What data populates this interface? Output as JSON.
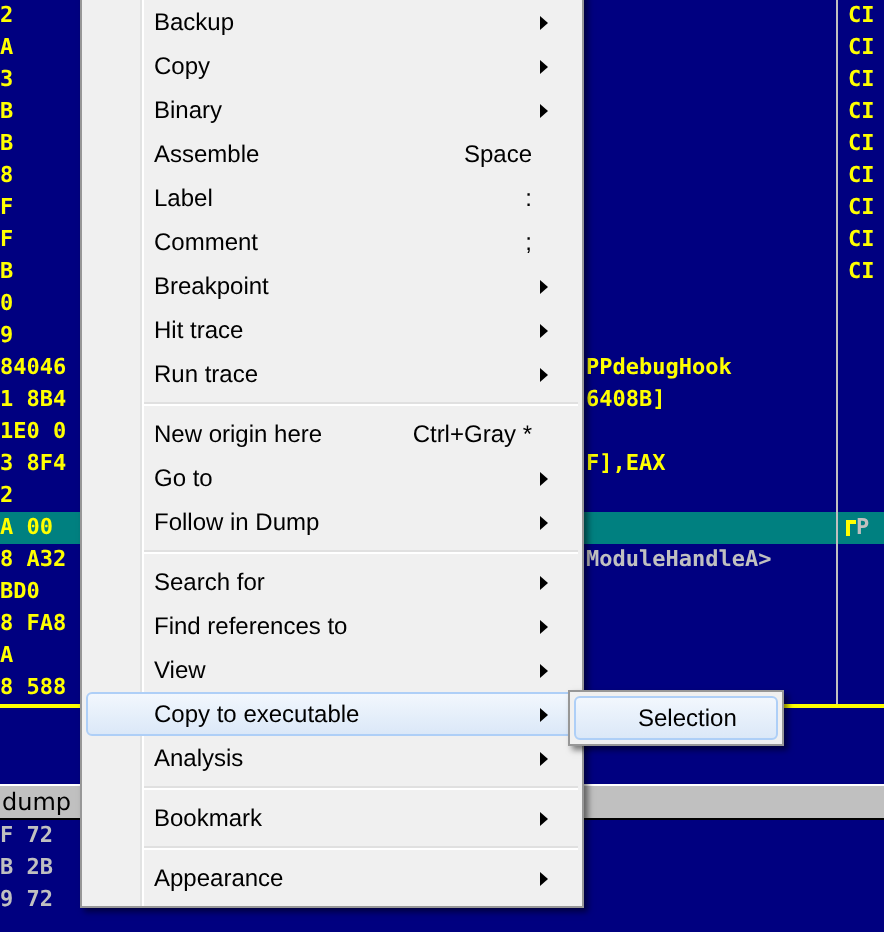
{
  "disasm": {
    "rows": [
      {
        "col_1": "2",
        "col_3": "CI",
        "selected": false
      },
      {
        "col_1": "A",
        "col_3": "CI",
        "selected": false
      },
      {
        "col_1": "3",
        "col_3": "CI",
        "selected": false
      },
      {
        "col_1": "B",
        "col_3": "CI",
        "selected": false
      },
      {
        "col_1": "B",
        "col_3": "CI",
        "selected": false
      },
      {
        "col_1": "8",
        "col_3": "CI",
        "selected": false
      },
      {
        "col_1": "F",
        "col_3": "CI",
        "selected": false
      },
      {
        "col_1": "F",
        "col_3": "CI",
        "selected": false
      },
      {
        "col_1": "B",
        "col_3": "CI",
        "selected": false
      },
      {
        "col_1": "0",
        "selected": false
      },
      {
        "col_1": "9",
        "selected": false
      },
      {
        "col_1": "84046",
        "col_2": "PPdebugHook",
        "color": "#ffff00",
        "selected": false
      },
      {
        "col_1": "1 8B4",
        "col_2": "6408B]",
        "color": "#ffff00",
        "selected": false
      },
      {
        "col_1": "1E0 0",
        "selected": false
      },
      {
        "col_1": "3 8F4",
        "col_2": "F],EAX",
        "color": "#ffff00",
        "selected": false
      },
      {
        "col_1": "2",
        "selected": false
      },
      {
        "col_1": "A 00",
        "col_3": "P",
        "selected": true
      },
      {
        "col_1": "8 A32",
        "col_2": "ModuleHandleA>",
        "color": "#c0c0c0",
        "selected": false
      },
      {
        "col_1": "BD0",
        "selected": false
      },
      {
        "col_1": "8 FA8",
        "selected": false
      },
      {
        "col_1": "A",
        "selected": false
      },
      {
        "col_1": "8 588",
        "selected": false
      }
    ]
  },
  "dump": {
    "title": "dump",
    "rows": [
      "F 72",
      "B 2B",
      "9 72"
    ]
  },
  "menu": {
    "items": [
      {
        "kind": "item",
        "label": "Backup",
        "submenu": true,
        "selected": false
      },
      {
        "kind": "item",
        "label": "Copy",
        "submenu": true,
        "selected": false
      },
      {
        "kind": "item",
        "label": "Binary",
        "submenu": true,
        "selected": false
      },
      {
        "kind": "item",
        "label": "Assemble",
        "shortcut": "Space",
        "submenu": false,
        "selected": false
      },
      {
        "kind": "item",
        "label": "Label",
        "shortcut": ":",
        "submenu": false,
        "selected": false
      },
      {
        "kind": "item",
        "label": "Comment",
        "shortcut": ";",
        "submenu": false,
        "selected": false
      },
      {
        "kind": "item",
        "label": "Breakpoint",
        "submenu": true,
        "selected": false
      },
      {
        "kind": "item",
        "label": "Hit trace",
        "submenu": true,
        "selected": false
      },
      {
        "kind": "item",
        "label": "Run trace",
        "submenu": true,
        "selected": false
      },
      {
        "kind": "separator"
      },
      {
        "kind": "item",
        "label": "New origin here",
        "shortcut": "Ctrl+Gray *",
        "submenu": false,
        "selected": false
      },
      {
        "kind": "item",
        "label": "Go to",
        "submenu": true,
        "selected": false
      },
      {
        "kind": "item",
        "label": "Follow in Dump",
        "submenu": true,
        "selected": false
      },
      {
        "kind": "separator"
      },
      {
        "kind": "item",
        "label": "Search for",
        "submenu": true,
        "selected": false
      },
      {
        "kind": "item",
        "label": "Find references to",
        "submenu": true,
        "selected": false
      },
      {
        "kind": "item",
        "label": "View",
        "submenu": true,
        "selected": false
      },
      {
        "kind": "item",
        "label": "Copy to executable",
        "submenu": true,
        "selected": true
      },
      {
        "kind": "item",
        "label": "Analysis",
        "submenu": true,
        "selected": false
      },
      {
        "kind": "separator"
      },
      {
        "kind": "item",
        "label": "Bookmark",
        "submenu": true,
        "selected": false
      },
      {
        "kind": "separator"
      },
      {
        "kind": "item",
        "label": "Appearance",
        "submenu": true,
        "selected": false
      }
    ]
  },
  "submenu": {
    "items": [
      {
        "label": "Selection",
        "selected": true
      }
    ]
  }
}
